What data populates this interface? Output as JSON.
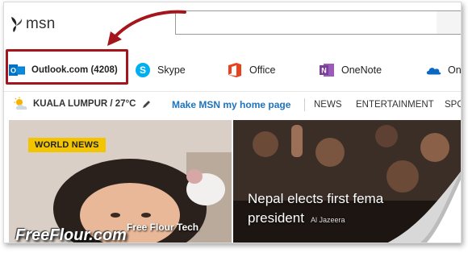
{
  "header": {
    "brand": "msn",
    "search_placeholder": ""
  },
  "services": [
    {
      "label": "Outlook.com (4208)",
      "icon": "outlook-icon",
      "color": "#0072c6"
    },
    {
      "label": "Skype",
      "icon": "skype-icon",
      "color": "#00aff0"
    },
    {
      "label": "Office",
      "icon": "office-icon",
      "color": "#e8431c"
    },
    {
      "label": "OneNote",
      "icon": "onenote-icon",
      "color": "#7b3f99"
    },
    {
      "label": "On",
      "icon": "onedrive-icon",
      "color": "#0a68c4"
    }
  ],
  "navbar": {
    "weather": "KUALA LUMPUR / 27°C",
    "home_link": "Make MSN my home page",
    "items": [
      "NEWS",
      "ENTERTAINMENT",
      "SPO"
    ]
  },
  "news": {
    "badge": "WORLD NEWS",
    "headline_line1": "Nepal elects first fema",
    "headline_line2": "president",
    "source": "Al Jazeera"
  },
  "watermark": {
    "small": "Free Flour Tech",
    "big": "FreeFlour.com"
  },
  "colors": {
    "highlight_border": "#a5151c",
    "link": "#1e73be",
    "badge": "#f3c400"
  }
}
